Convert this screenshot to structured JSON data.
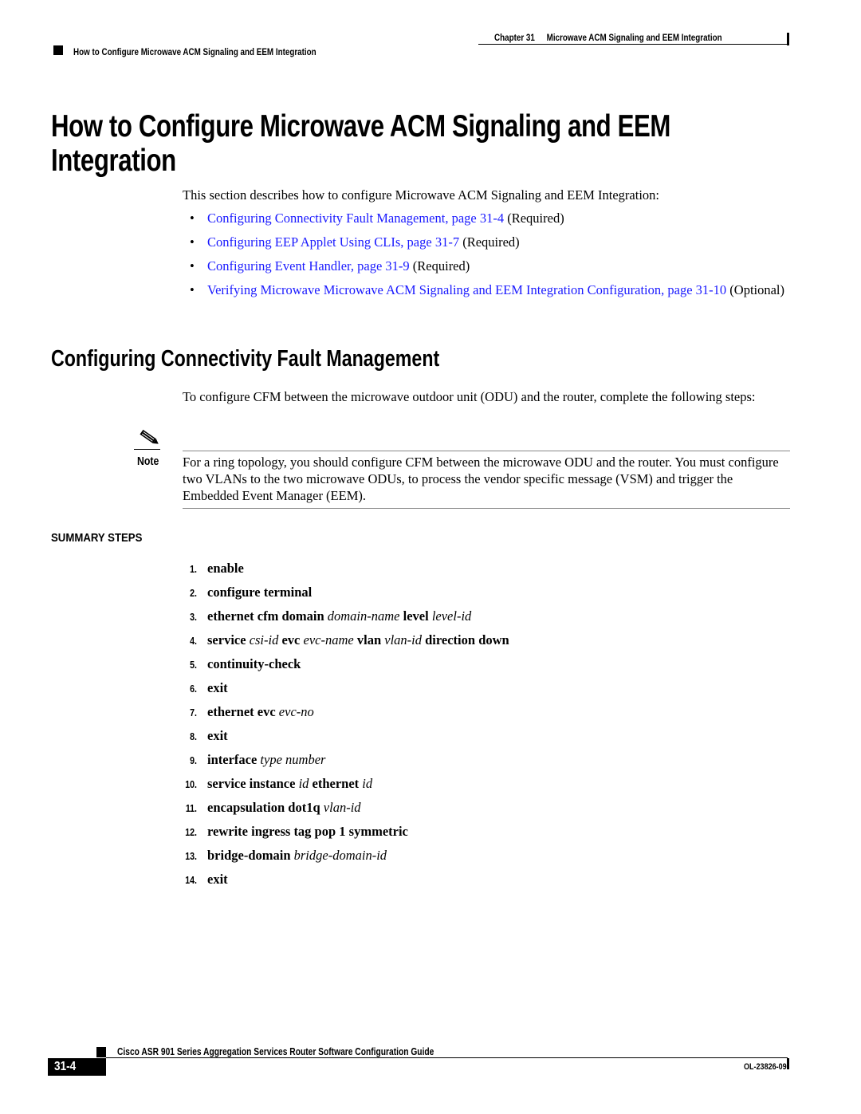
{
  "header": {
    "chapter_label": "Chapter 31",
    "chapter_title": "Microwave ACM Signaling and EEM Integration",
    "section_title": "How to Configure Microwave ACM Signaling and EEM Integration"
  },
  "page_title": "How to Configure Microwave ACM Signaling and EEM Integration",
  "intro": "This section describes how to configure Microwave ACM Signaling and EEM Integration:",
  "bullet_glyph": "•",
  "tasks": [
    {
      "link": "Configuring Connectivity Fault Management, page 31-4",
      "suffix": " (Required)"
    },
    {
      "link": "Configuring EEP Applet Using CLIs, page 31-7",
      "suffix": " (Required)"
    },
    {
      "link": "Configuring Event Handler, page 31-9",
      "suffix": " (Required)"
    },
    {
      "link": "Verifying Microwave Microwave ACM Signaling and EEM Integration Configuration, page 31-10",
      "suffix": " (Optional)"
    }
  ],
  "section": {
    "title": "Configuring Connectivity Fault Management",
    "intro": "To configure CFM between the microwave outdoor unit (ODU) and the router, complete the following steps:"
  },
  "note": {
    "label": "Note",
    "icon": "pencil-note-icon",
    "text": "For a ring topology, you should configure CFM between the microwave ODU and the router. You must configure two VLANs to the two microwave ODUs, to process the vendor specific message (VSM) and trigger the Embedded Event Manager (EEM)."
  },
  "summary_steps": {
    "title": "SUMMARY STEPS",
    "steps": [
      {
        "num": "1.",
        "parts": [
          {
            "t": "enable",
            "s": "b"
          }
        ]
      },
      {
        "num": "2.",
        "parts": [
          {
            "t": "configure terminal",
            "s": "b"
          }
        ]
      },
      {
        "num": "3.",
        "parts": [
          {
            "t": "ethernet cfm domain ",
            "s": "b"
          },
          {
            "t": "domain-name",
            "s": "i"
          },
          {
            "t": " level ",
            "s": "b"
          },
          {
            "t": "level-id",
            "s": "i"
          }
        ]
      },
      {
        "num": "4.",
        "parts": [
          {
            "t": "service ",
            "s": "b"
          },
          {
            "t": "csi-id",
            "s": "i"
          },
          {
            "t": " evc ",
            "s": "b"
          },
          {
            "t": "evc-name",
            "s": "i"
          },
          {
            "t": " vlan ",
            "s": "b"
          },
          {
            "t": "vlan-id",
            "s": "i"
          },
          {
            "t": " direction down",
            "s": "b"
          }
        ]
      },
      {
        "num": "5.",
        "parts": [
          {
            "t": "continuity-check",
            "s": "b"
          }
        ]
      },
      {
        "num": "6.",
        "parts": [
          {
            "t": "exit",
            "s": "b"
          }
        ]
      },
      {
        "num": "7.",
        "parts": [
          {
            "t": "ethernet evc ",
            "s": "b"
          },
          {
            "t": "evc-no",
            "s": "i"
          }
        ]
      },
      {
        "num": "8.",
        "parts": [
          {
            "t": "exit",
            "s": "b"
          }
        ]
      },
      {
        "num": "9.",
        "parts": [
          {
            "t": "interface ",
            "s": "b"
          },
          {
            "t": "type number",
            "s": "i"
          }
        ]
      },
      {
        "num": "10.",
        "parts": [
          {
            "t": "service instance ",
            "s": "b"
          },
          {
            "t": "id",
            "s": "i"
          },
          {
            "t": " ethernet ",
            "s": "b"
          },
          {
            "t": "id",
            "s": "i"
          }
        ]
      },
      {
        "num": "11.",
        "parts": [
          {
            "t": "encapsulation dot1q ",
            "s": "b"
          },
          {
            "t": "vlan-id",
            "s": "i"
          }
        ]
      },
      {
        "num": "12.",
        "parts": [
          {
            "t": "rewrite ingress tag pop 1 symmetric",
            "s": "b"
          }
        ]
      },
      {
        "num": "13.",
        "parts": [
          {
            "t": "bridge-domain ",
            "s": "b"
          },
          {
            "t": "bridge-domain-id",
            "s": "i"
          }
        ]
      },
      {
        "num": "14.",
        "parts": [
          {
            "t": "exit",
            "s": "b"
          }
        ]
      }
    ]
  },
  "footer": {
    "guide_title": "Cisco ASR 901 Series Aggregation Services Router Software Configuration Guide",
    "page_number": "31-4",
    "doc_number": "OL-23826-09"
  },
  "colors": {
    "link": "#1a1aff",
    "text": "#000000",
    "rule": "#888888"
  }
}
